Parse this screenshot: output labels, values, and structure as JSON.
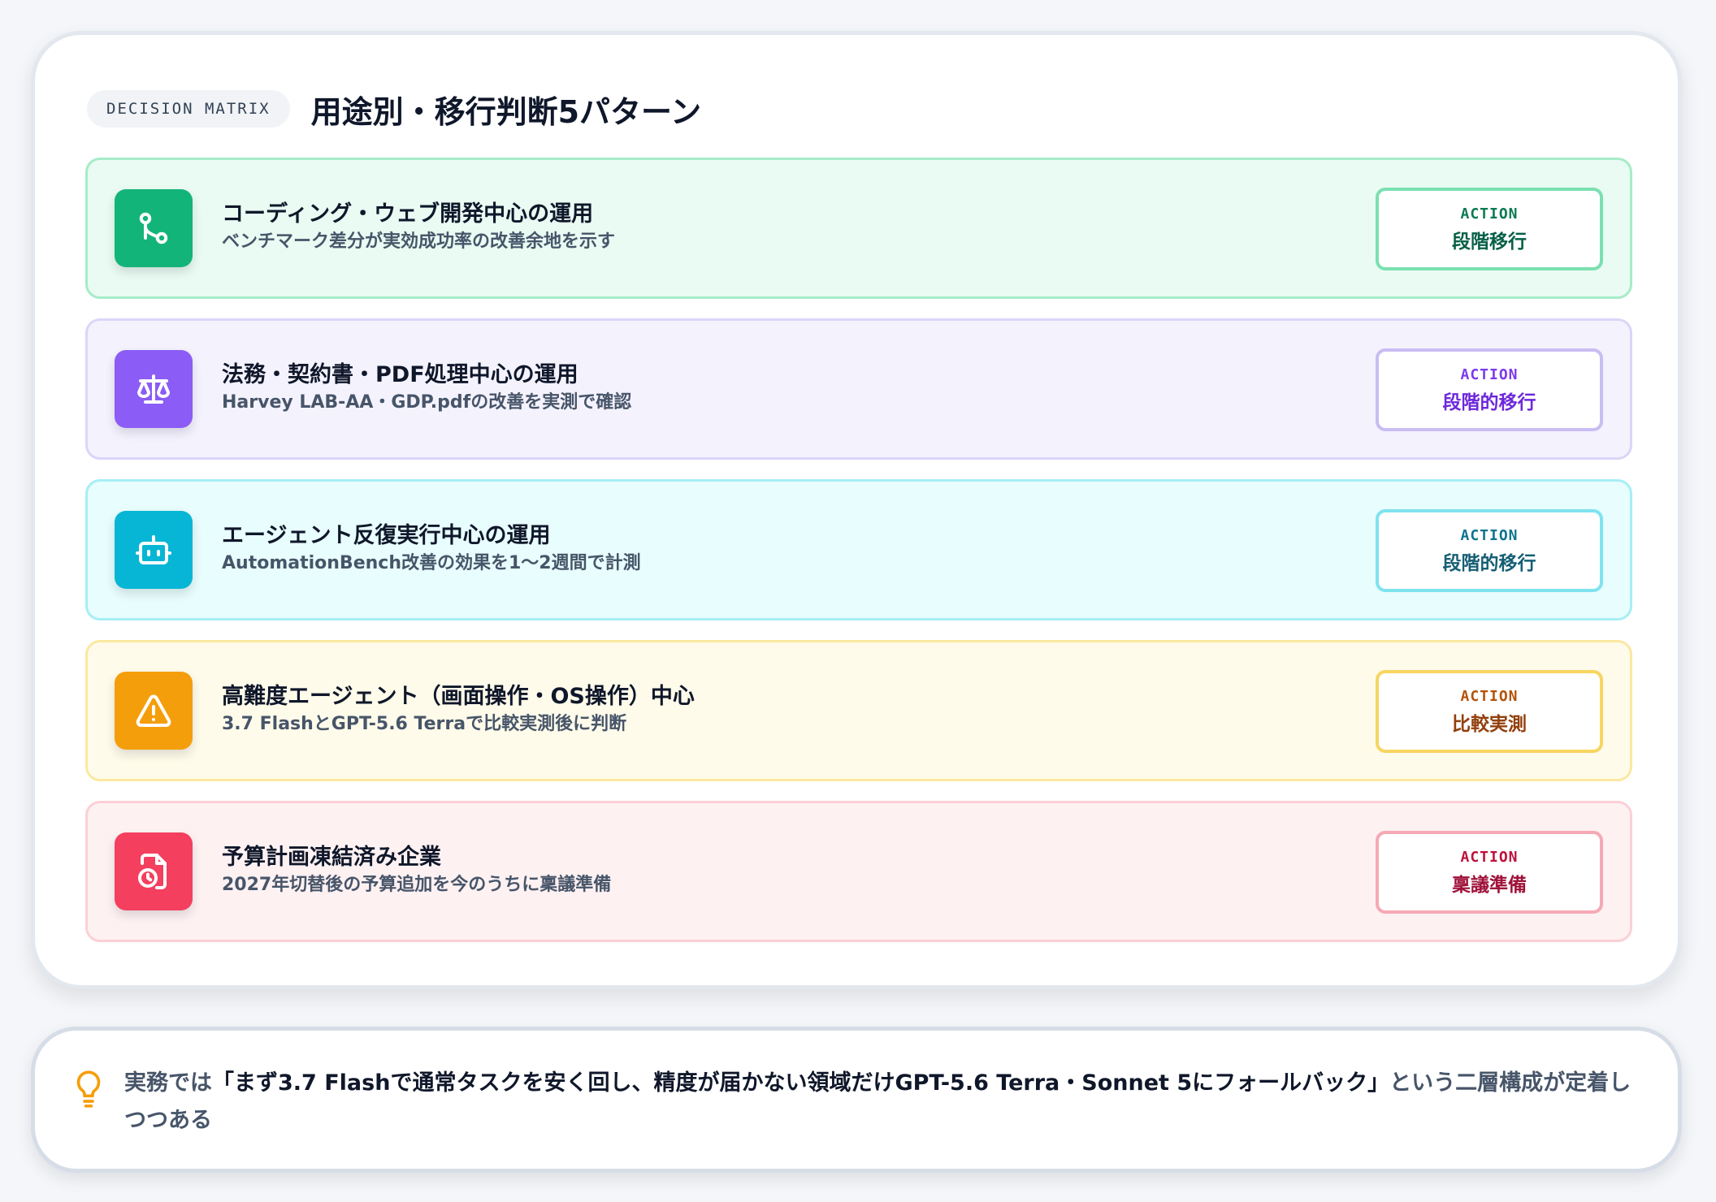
{
  "header": {
    "tag": "DECISION MATRIX",
    "title": "用途別・移行判断5パターン"
  },
  "rows": [
    {
      "icon": "git-merge-icon",
      "title": "コーディング・ウェブ開発中心の運用",
      "subtitle": "ベンチマーク差分が実効成功率の改善余地を示す",
      "action_label": "ACTION",
      "action_value": "段階移行",
      "colors": {
        "bg": "#e9fbf2",
        "border": "#a6ecc8",
        "icon_bg": "#12b47a",
        "action_border": "#7be0b1",
        "action_label": "#0b7a52",
        "action_value": "#065f46"
      }
    },
    {
      "icon": "scale-icon",
      "title": "法務・契約書・PDF処理中心の運用",
      "subtitle": "Harvey LAB-AA・GDP.pdfの改善を実測で確認",
      "action_label": "ACTION",
      "action_value": "段階的移行",
      "colors": {
        "bg": "#f4f2fd",
        "border": "#dcd5f8",
        "icon_bg": "#8b5cf6",
        "action_border": "#c9bdf3",
        "action_label": "#7c3aed",
        "action_value": "#6d28d9"
      }
    },
    {
      "icon": "bot-icon",
      "title": "エージェント反復実行中心の運用",
      "subtitle": "AutomationBench改善の効果を1〜2週間で計測",
      "action_label": "ACTION",
      "action_value": "段階的移行",
      "colors": {
        "bg": "#e8fdfd",
        "border": "#a7eef5",
        "icon_bg": "#06b6d4",
        "action_border": "#7fe3ef",
        "action_label": "#0e7490",
        "action_value": "#155e75"
      }
    },
    {
      "icon": "warning-icon",
      "title": "高難度エージェント（画面操作・OS操作）中心",
      "subtitle": "3.7 FlashとGPT-5.6 Terraで比較実測後に判断",
      "action_label": "ACTION",
      "action_value": "比較実測",
      "colors": {
        "bg": "#fffbea",
        "border": "#fbe8a0",
        "icon_bg": "#f59e0b",
        "action_border": "#f7d560",
        "action_label": "#b45309",
        "action_value": "#92400e"
      }
    },
    {
      "icon": "file-clock-icon",
      "title": "予算計画凍結済み企業",
      "subtitle": "2027年切替後の予算追加を今のうちに稟議準備",
      "action_label": "ACTION",
      "action_value": "稟議準備",
      "colors": {
        "bg": "#fef1f2",
        "border": "#fbd0d6",
        "icon_bg": "#f43f5e",
        "action_border": "#f6a9b5",
        "action_label": "#be123c",
        "action_value": "#9f1239"
      }
    }
  ],
  "note": {
    "icon": "lightbulb-icon",
    "prefix": "実務では",
    "emphasis": "「まず3.7 Flashで通常タスクを安く回し、精度が届かない領域だけGPT-5.6 Terra・Sonnet 5にフォールバック」",
    "suffix": "という二層構成が定着しつつある",
    "icon_color": "#f59e0b"
  }
}
